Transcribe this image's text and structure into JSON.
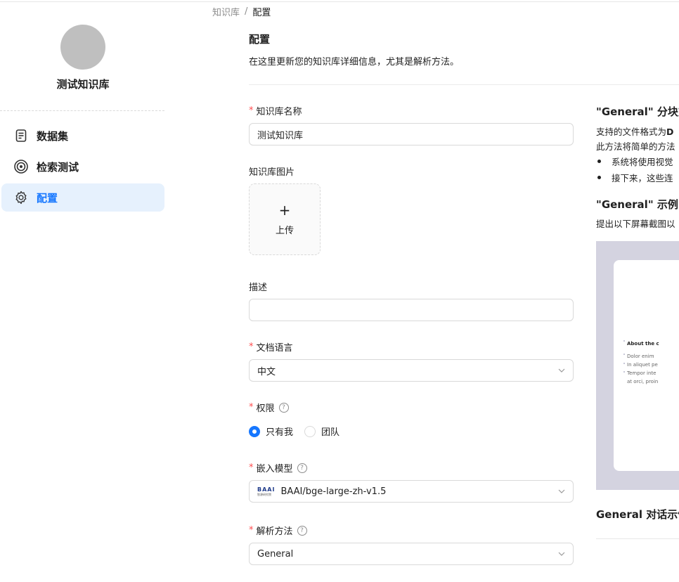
{
  "breadcrumb": {
    "root": "知识库",
    "separator": "/",
    "current": "配置"
  },
  "sidebar": {
    "kb_name": "测试知识库",
    "items": [
      {
        "label": "数据集",
        "icon": "document-icon"
      },
      {
        "label": "检索测试",
        "icon": "target-icon"
      },
      {
        "label": "配置",
        "icon": "gear-icon",
        "active": true
      }
    ]
  },
  "header": {
    "title": "配置",
    "description": "在这里更新您的知识库详细信息，尤其是解析方法。"
  },
  "form": {
    "name": {
      "label": "知识库名称",
      "value": "测试知识库"
    },
    "image": {
      "label": "知识库图片",
      "upload_label": "上传"
    },
    "description": {
      "label": "描述",
      "value": ""
    },
    "language": {
      "label": "文档语言",
      "value": "中文"
    },
    "permission": {
      "label": "权限",
      "options": [
        "只有我",
        "团队"
      ],
      "selected": "只有我"
    },
    "embedding": {
      "label": "嵌入模型",
      "logo_text": "BAAI",
      "logo_sub": "智源研究院",
      "value": "BAAI/bge-large-zh-v1.5"
    },
    "parser": {
      "label": "解析方法",
      "value": "General"
    },
    "help_glyph": "?"
  },
  "colors": {
    "accent": "#1677ff",
    "required": "#ff4d4f",
    "active_bg": "#e6f1fd"
  },
  "right_panel": {
    "title1": "\"General\" 分块方",
    "line1_prefix": "支持的文件格式为",
    "line1_bold": "D",
    "line2": "此方法将简单的方法",
    "bullets": [
      "系统将使用视觉",
      "接下来，这些连"
    ],
    "title2": "\"General\" 示例",
    "line3": "提出以下屏幕截图以",
    "doc_lines": [
      "About the c",
      "Dolor enim",
      "In aliquet pe",
      "Tempor inte",
      "at orci, proin"
    ],
    "title3": "General 对话示例"
  }
}
